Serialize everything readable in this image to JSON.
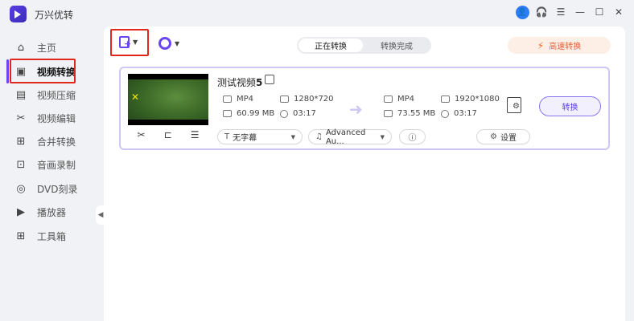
{
  "app": {
    "title": "万兴优转"
  },
  "window": {
    "user_icon": "user-icon",
    "help_icon": "headset-icon",
    "menu_icon": "menu-icon",
    "minimize": "—",
    "maximize": "☐",
    "close": "✕"
  },
  "sidebar": {
    "items": [
      {
        "label": "主页",
        "icon": "home-icon"
      },
      {
        "label": "视频转换",
        "icon": "convert-icon",
        "active": true
      },
      {
        "label": "视频压缩",
        "icon": "compress-icon"
      },
      {
        "label": "视频编辑",
        "icon": "scissors-icon"
      },
      {
        "label": "合并转换",
        "icon": "merge-icon"
      },
      {
        "label": "音画录制",
        "icon": "record-icon"
      },
      {
        "label": "DVD刻录",
        "icon": "disc-icon"
      },
      {
        "label": "播放器",
        "icon": "player-icon"
      },
      {
        "label": "工具箱",
        "icon": "toolbox-icon"
      }
    ]
  },
  "toolbar": {
    "tabs": {
      "converting": "正在转换",
      "finished": "转换完成"
    },
    "speed_label": "高速转换"
  },
  "file": {
    "name": "测试视频",
    "name_suffix": "5",
    "source": {
      "format": "MP4",
      "resolution": "1280*720",
      "size": "60.99 MB",
      "duration": "03:17"
    },
    "target": {
      "format": "MP4",
      "resolution": "1920*1080",
      "size": "73.55 MB",
      "duration": "03:17"
    },
    "convert_label": "转换",
    "subtitle": "无字幕",
    "audio": "Advanced Au...",
    "settings_label": "设置"
  }
}
